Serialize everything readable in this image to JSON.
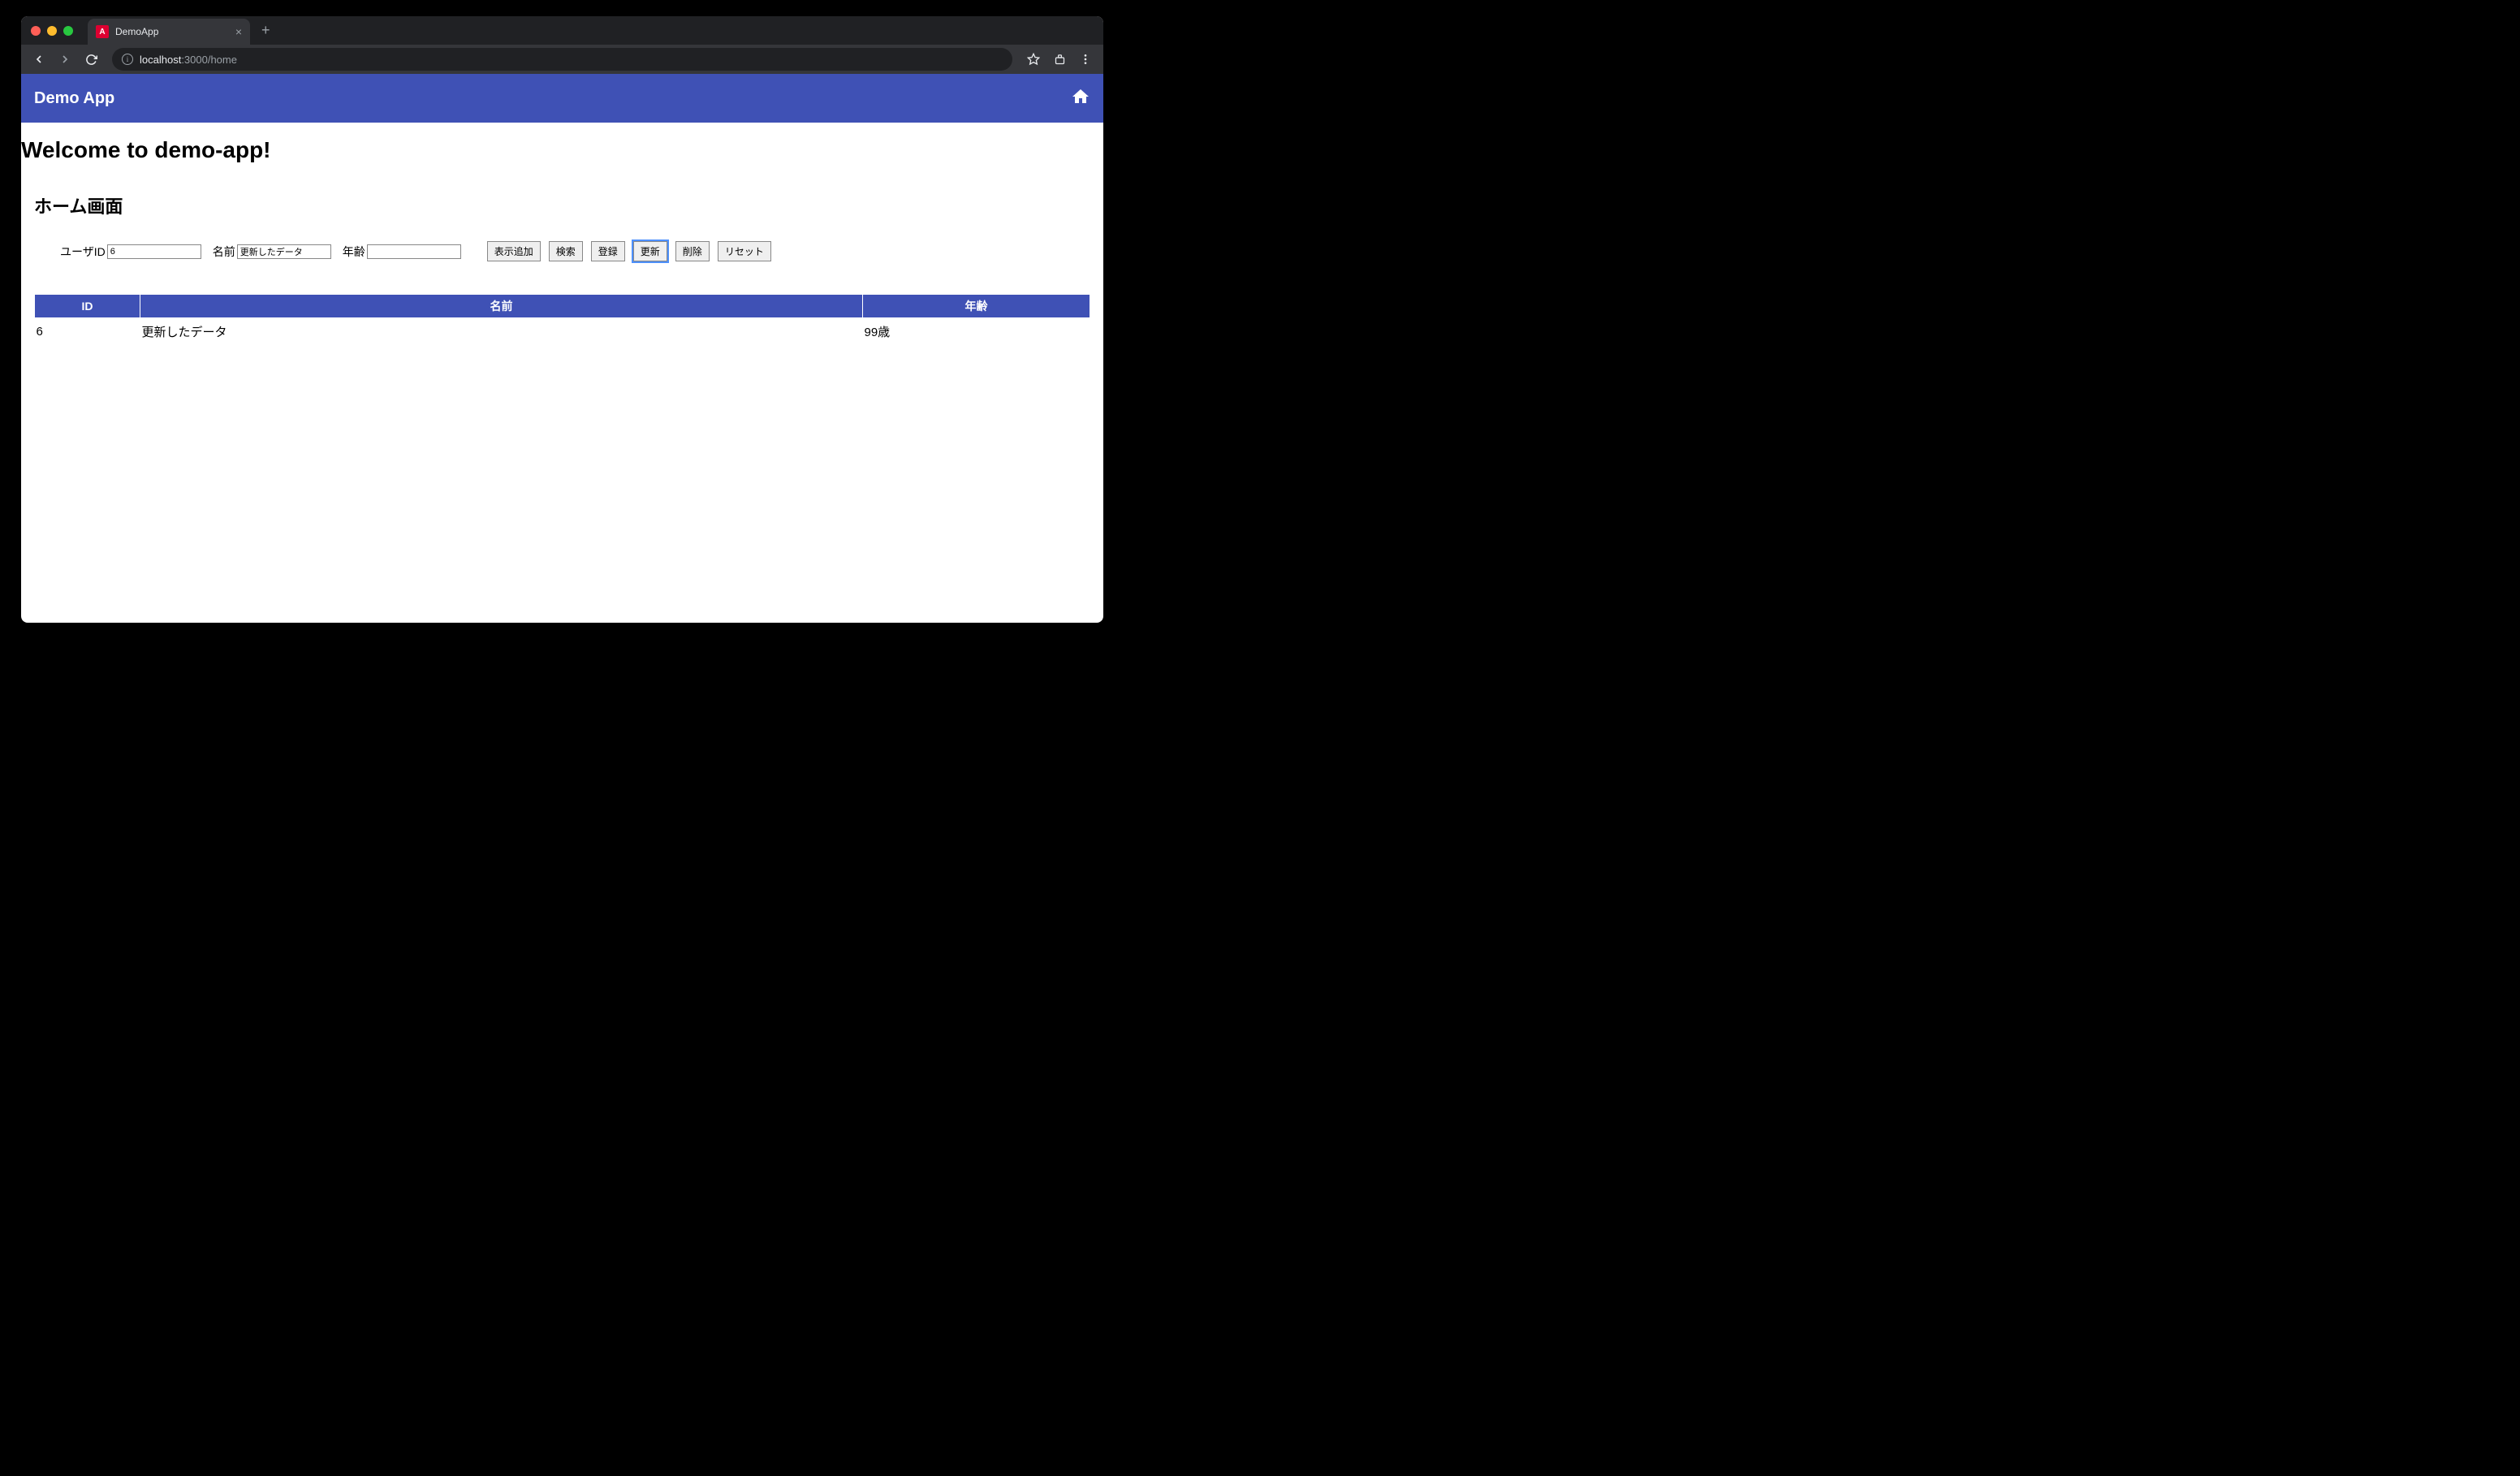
{
  "browser": {
    "tab_title": "DemoApp",
    "url_host": "localhost",
    "url_port_path": ":3000/home"
  },
  "header": {
    "app_title": "Demo App"
  },
  "main": {
    "welcome_heading": "Welcome to demo-app!",
    "section_title": "ホーム画面",
    "form": {
      "user_id_label": "ユーザID",
      "user_id_value": "6",
      "name_label": "名前",
      "name_value": "更新したデータ",
      "age_label": "年齢",
      "age_value": ""
    },
    "buttons": {
      "add_display": "表示追加",
      "search": "検索",
      "register": "登録",
      "update": "更新",
      "delete": "削除",
      "reset": "リセット"
    },
    "table": {
      "headers": {
        "id": "ID",
        "name": "名前",
        "age": "年齢"
      },
      "rows": [
        {
          "id": "6",
          "name": "更新したデータ",
          "age": "99歳"
        }
      ]
    }
  }
}
